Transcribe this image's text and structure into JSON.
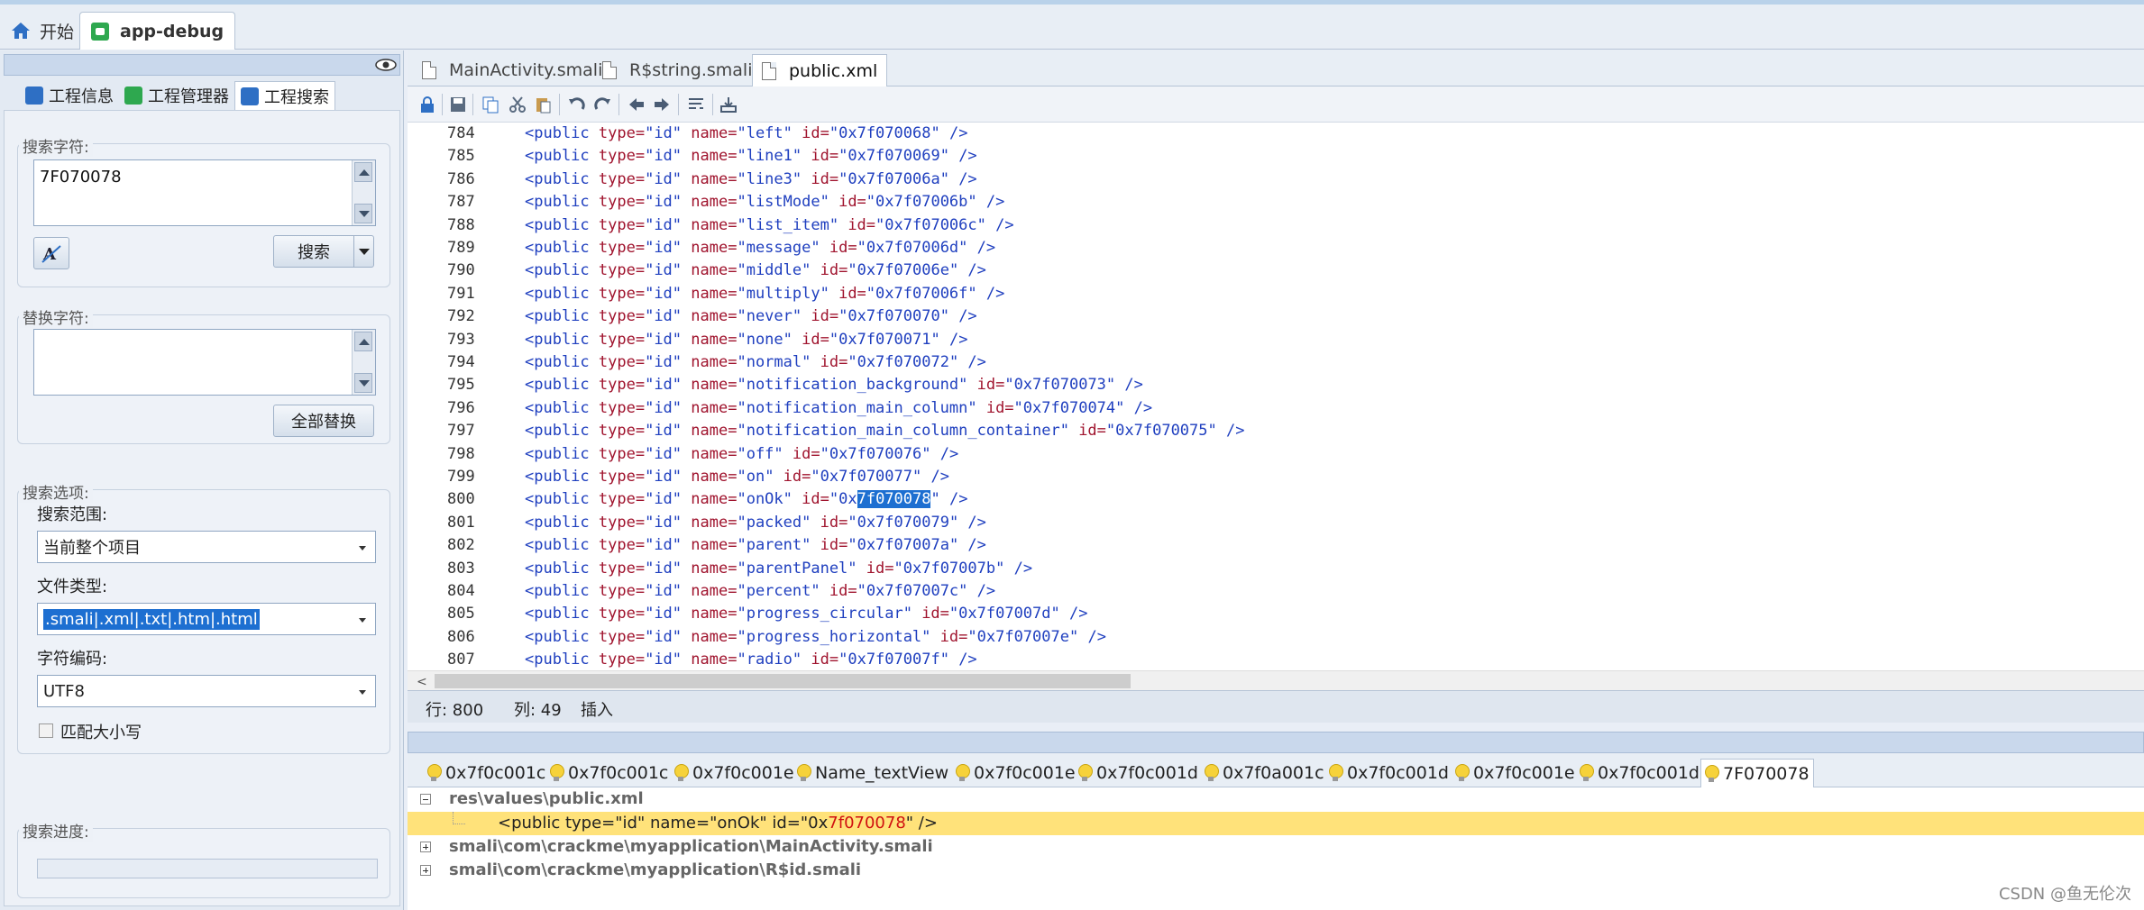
{
  "window_tabs": [
    {
      "label": "开始",
      "icon": "home-icon"
    },
    {
      "label": "app-debug",
      "icon": "android-app-icon"
    }
  ],
  "left": {
    "tabs": [
      {
        "label": "工程信息",
        "icon": "info-icon",
        "color": "#2e6fc4"
      },
      {
        "label": "工程管理器",
        "icon": "android-icon",
        "color": "#2ea84f"
      },
      {
        "label": "工程搜索",
        "icon": "search-icon",
        "color": "#2e6fc4"
      }
    ],
    "search_label": "搜索字符:",
    "search_value": "7F070078",
    "search_button": "搜索",
    "replace_label": "替换字符:",
    "replace_value": "",
    "replace_all_button": "全部替换",
    "options_label": "搜索选项:",
    "scope_label": "搜索范围:",
    "scope_value": "当前整个项目",
    "filetype_label": "文件类型:",
    "filetype_value": ".smali|.xml|.txt|.htm|.html",
    "encoding_label": "字符编码:",
    "encoding_value": "UTF8",
    "match_case_label": "匹配大小写",
    "progress_label": "搜索进度:"
  },
  "file_tabs": [
    {
      "label": "MainActivity.smali"
    },
    {
      "label": "R$string.smali"
    },
    {
      "label": "public.xml"
    }
  ],
  "code_lines": [
    {
      "ln": "784",
      "name": "left",
      "id": "0x7f070068"
    },
    {
      "ln": "785",
      "name": "line1",
      "id": "0x7f070069"
    },
    {
      "ln": "786",
      "name": "line3",
      "id": "0x7f07006a"
    },
    {
      "ln": "787",
      "name": "listMode",
      "id": "0x7f07006b"
    },
    {
      "ln": "788",
      "name": "list_item",
      "id": "0x7f07006c"
    },
    {
      "ln": "789",
      "name": "message",
      "id": "0x7f07006d"
    },
    {
      "ln": "790",
      "name": "middle",
      "id": "0x7f07006e"
    },
    {
      "ln": "791",
      "name": "multiply",
      "id": "0x7f07006f"
    },
    {
      "ln": "792",
      "name": "never",
      "id": "0x7f070070"
    },
    {
      "ln": "793",
      "name": "none",
      "id": "0x7f070071"
    },
    {
      "ln": "794",
      "name": "normal",
      "id": "0x7f070072"
    },
    {
      "ln": "795",
      "name": "notification_background",
      "id": "0x7f070073"
    },
    {
      "ln": "796",
      "name": "notification_main_column",
      "id": "0x7f070074"
    },
    {
      "ln": "797",
      "name": "notification_main_column_container",
      "id": "0x7f070075"
    },
    {
      "ln": "798",
      "name": "off",
      "id": "0x7f070076"
    },
    {
      "ln": "799",
      "name": "on",
      "id": "0x7f070077"
    },
    {
      "ln": "800",
      "name": "onOk",
      "id_prefix": "0x",
      "id_highlight": "7f070078",
      "highlight": true
    },
    {
      "ln": "801",
      "name": "packed",
      "id": "0x7f070079"
    },
    {
      "ln": "802",
      "name": "parent",
      "id": "0x7f07007a"
    },
    {
      "ln": "803",
      "name": "parentPanel",
      "id": "0x7f07007b"
    },
    {
      "ln": "804",
      "name": "percent",
      "id": "0x7f07007c"
    },
    {
      "ln": "805",
      "name": "progress_circular",
      "id": "0x7f07007d"
    },
    {
      "ln": "806",
      "name": "progress_horizontal",
      "id": "0x7f07007e"
    },
    {
      "ln": "807",
      "name": "radio",
      "id": "0x7f07007f"
    }
  ],
  "code_parts": {
    "open": "<public ",
    "type_attr": "type=",
    "type_val": "\"id\"",
    "name_attr": " name=",
    "id_attr": " id=",
    "close": " />"
  },
  "status": {
    "line": "行: 800",
    "col": "列: 49",
    "mode": "插入"
  },
  "result_tabs": [
    "0x7f0c001c",
    "0x7f0c001c",
    "0x7f0c001e",
    "Name_textView",
    "0x7f0c001e",
    "0x7f0c001d",
    "0x7f0a001c",
    "0x7f0c001d",
    "0x7f0c001e",
    "0x7f0c001d",
    "7F070078"
  ],
  "results": {
    "file1": "res\\values\\public.xml",
    "match_prefix": "<public type=\"id\" name=\"onOk\" id=\"0x",
    "match_hit": "7f070078",
    "match_suffix": "\" />",
    "file2": "smali\\com\\crackme\\myapplication\\MainActivity.smali",
    "file3": "smali\\com\\crackme\\myapplication\\R$id.smali"
  },
  "watermark": "CSDN @鱼无伦次"
}
